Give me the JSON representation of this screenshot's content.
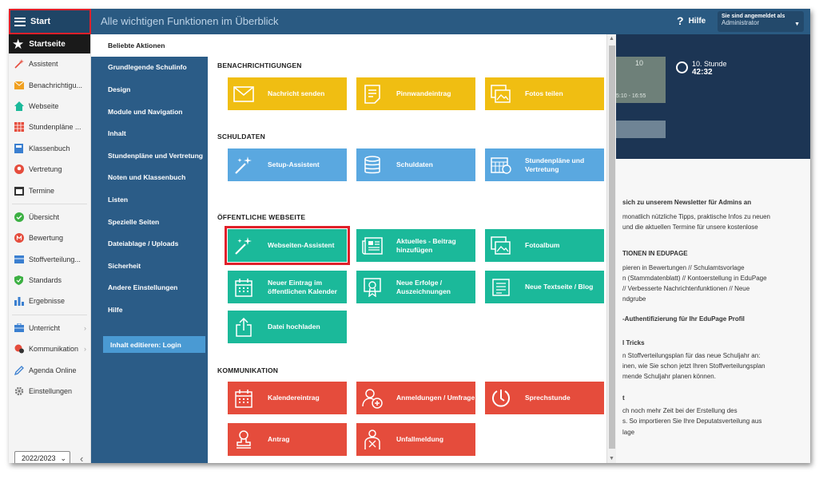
{
  "topbar": {
    "start_label": "Start",
    "title": "Alle wichtigen Funktionen im Überblick",
    "help_label": "Hilfe",
    "login_line1": "Sie sind angemeldet als",
    "login_user": "Administrator"
  },
  "sidebar": {
    "active": "Startseite",
    "items": [
      {
        "label": "Assistent",
        "icon": "magic-wand-icon",
        "color": "#e54c3c"
      },
      {
        "label": "Benachrichtigu...",
        "icon": "envelope-icon",
        "color": "#f0a020"
      },
      {
        "label": "Webseite",
        "icon": "home-icon",
        "color": "#1bb99a"
      },
      {
        "label": "Stundenpläne ...",
        "icon": "timetable-icon",
        "color": "#e54c3c"
      },
      {
        "label": "Klassenbuch",
        "icon": "book-icon",
        "color": "#3a7fd0"
      },
      {
        "label": "Vertretung",
        "icon": "substitute-icon",
        "color": "#e54c3c"
      },
      {
        "label": "Termine",
        "icon": "calendar-icon",
        "color": "#333333"
      }
    ],
    "items2": [
      {
        "label": "Übersicht",
        "icon": "check-icon",
        "color": "#3cb043"
      },
      {
        "label": "Bewertung",
        "icon": "grade-icon",
        "color": "#e54c3c"
      },
      {
        "label": "Stoffverteilung...",
        "icon": "plan-icon",
        "color": "#3a7fd0"
      },
      {
        "label": "Standards",
        "icon": "shield-check-icon",
        "color": "#3cb043"
      },
      {
        "label": "Ergebnisse",
        "icon": "bar-chart-icon",
        "color": "#3a7fd0"
      }
    ],
    "items3": [
      {
        "label": "Unterricht",
        "icon": "briefcase-icon",
        "color": "#3a7fd0"
      },
      {
        "label": "Kommunikation",
        "icon": "chat-icon",
        "color": "#e54c3c"
      },
      {
        "label": "Agenda Online",
        "icon": "pen-icon",
        "color": "#3a7fd0"
      },
      {
        "label": "Einstellungen",
        "icon": "gear-icon",
        "color": "#777777"
      }
    ],
    "year": "2022/2023"
  },
  "menu": {
    "items": [
      "Beliebte Aktionen",
      "Grundlegende Schulinfo",
      "Design",
      "Module und Navigation",
      "Inhalt",
      "Stundenpläne und Vertretung",
      "Noten und Klassenbuch",
      "Listen",
      "Spezielle Seiten",
      "Dateiablage / Uploads",
      "Sicherheit",
      "Andere Einstellungen",
      "Hilfe"
    ],
    "edit_button": "Inhalt editieren: Login"
  },
  "panel": {
    "sections": {
      "notifications": "BENACHRICHTIGUNGEN",
      "schooldata": "SCHULDATEN",
      "website": "ÖFFENTLICHE WEBSEITE",
      "communication": "KOMMUNIKATION"
    },
    "tiles": {
      "message": "Nachricht senden",
      "pinboard": "Pinnwandeintrag",
      "photos": "Fotos teilen",
      "setup": "Setup-Assistent",
      "schooldata": "Schuldaten",
      "timetables": "Stundenpläne und Vertretung",
      "webassist": "Webseiten-Assistent",
      "news": "Aktuelles - Beitrag hinzufügen",
      "album": "Fotoalbum",
      "calendar": "Neuer Eintrag im öffentlichen Kalender",
      "achievements": "Neue Erfolge / Auszeichnungen",
      "textpage": "Neue Textseite / Blog",
      "upload": "Datei hochladen",
      "calentry": "Kalendereintrag",
      "registrations": "Anmeldungen / Umfrage",
      "consult": "Sprechstunde",
      "request": "Antrag",
      "accident": "Unfallmeldung"
    }
  },
  "dashboard": {
    "tt_number": "10",
    "tt_time": "5:10 - 16:55",
    "clock_label": "10. Stunde",
    "clock_time": "42:32",
    "news_lines": [
      "sich zu unserem Newsletter für Admins an",
      "monatlich nützliche Tipps, praktische Infos zu neuen",
      "und die aktuellen Termine für unsere kostenlose",
      "TIONEN IN EDUPAGE",
      "pieren in Bewertungen // Schulamtsvorlage",
      "n (Stammdatenblatt) // Kontoerstellung in EduPage",
      "// Verbesserte Nachrichtenfunktionen // Neue",
      "ndgrube",
      "-Authentifizierung für Ihr EduPage Profil",
      "l Tricks",
      "n Stoffverteilungsplan für das neue Schuljahr an:",
      "inen, wie Sie schon jetzt Ihren Stoffverteilungsplan",
      "mende Schuljahr planen können.",
      "t",
      "ch noch mehr Zeit bei der Erstellung des",
      "s. So importieren Sie Ihre Deputatsverteilung aus",
      "lage"
    ]
  }
}
